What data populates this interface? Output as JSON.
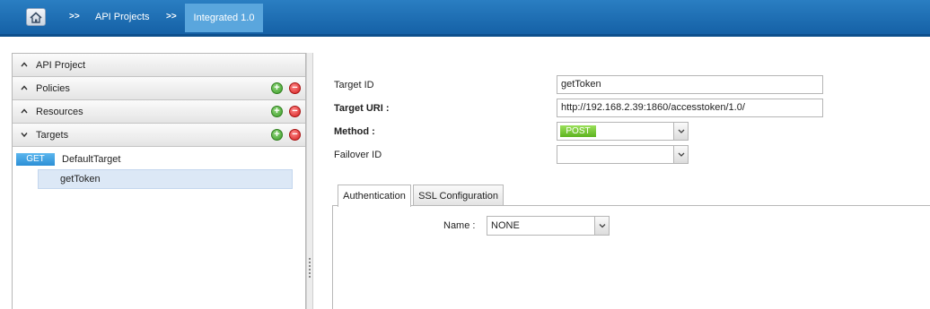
{
  "breadcrumb": {
    "separator": ">>",
    "items": [
      "API Projects"
    ],
    "active": "Integrated 1.0"
  },
  "tree": {
    "sections": {
      "api_project": "API Project",
      "policies": "Policies",
      "resources": "Resources",
      "targets": "Targets"
    },
    "targets": {
      "method_badge": "GET",
      "default_target": "DefaultTarget",
      "child": "getToken"
    },
    "add_symbol": "+",
    "remove_symbol": "−"
  },
  "form": {
    "target_id_label": "Target ID",
    "target_id_value": "getToken",
    "target_uri_label": "Target URI :",
    "target_uri_value": "http://192.168.2.39:1860/accesstoken/1.0/",
    "method_label": "Method :",
    "method_value": "POST",
    "failover_label": "Failover ID",
    "failover_value": ""
  },
  "tabs": {
    "authentication": "Authentication",
    "ssl": "SSL Configuration"
  },
  "auth": {
    "name_label": "Name :",
    "name_value": "NONE"
  },
  "colors": {
    "topbar": "#1a6ab2",
    "active_crumb": "#5aa6dd",
    "get_badge": "#3a9de0",
    "post_badge": "#6cc22e"
  },
  "icons": {
    "home": "home-icon",
    "chevron_up": "chevron-up-icon",
    "chevron_down": "chevron-down-icon",
    "add": "add-icon",
    "remove": "remove-icon",
    "dropdown": "dropdown-arrow-icon"
  }
}
